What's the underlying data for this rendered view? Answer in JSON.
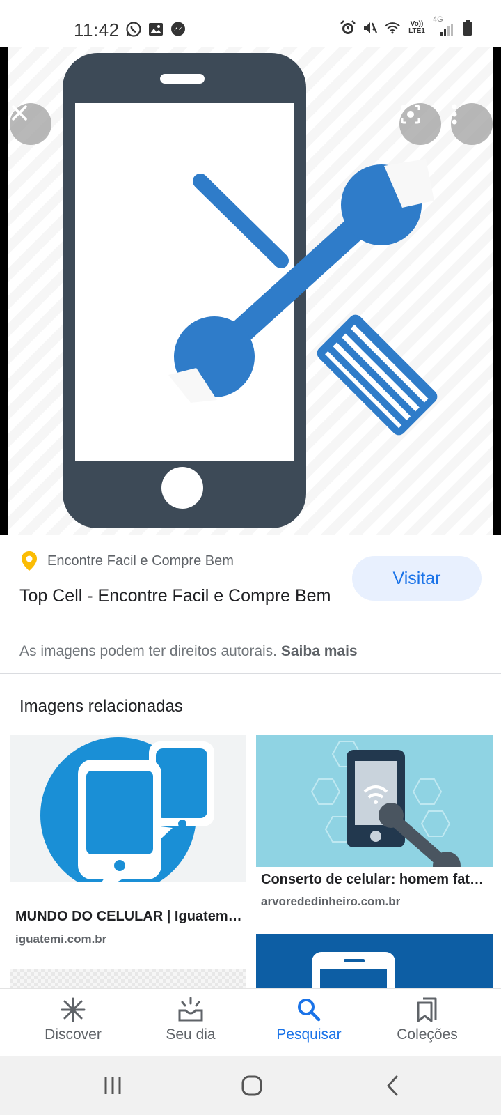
{
  "status_bar": {
    "time": "11:42",
    "left_icons": [
      "whatsapp-icon",
      "gallery-icon",
      "messenger-icon"
    ],
    "right_icons": [
      "alarm-icon",
      "mute-icon",
      "wifi-icon",
      "volte-icon",
      "signal-icon",
      "battery-icon"
    ],
    "volte_top": "Vo))",
    "volte_bottom": "LTE1",
    "network": "4G"
  },
  "hero": {
    "close_icon": "close-icon",
    "lens_icon": "lens-icon",
    "more_icon": "more-vert-icon"
  },
  "result": {
    "source": "Encontre Facil e Compre Bem",
    "title": "Top Cell - Encontre Facil e Compre Bem",
    "visit_label": "Visitar",
    "copyright_text": "As imagens podem ter direitos autorais.",
    "learn_more": "Saiba mais"
  },
  "related": {
    "heading": "Imagens relacionadas",
    "items": [
      {
        "title": "MUNDO DO CELULAR | Iguatem…",
        "domain": "iguatemi.com.br"
      },
      {
        "title": "Conserto de celular: homem fat…",
        "domain": "arvorededinheiro.com.br"
      }
    ]
  },
  "bottom_nav": {
    "items": [
      {
        "label": "Discover",
        "icon": "asterisk-icon",
        "active": false
      },
      {
        "label": "Seu dia",
        "icon": "sunrise-icon",
        "active": false
      },
      {
        "label": "Pesquisar",
        "icon": "search-icon",
        "active": true
      },
      {
        "label": "Coleções",
        "icon": "bookmarks-icon",
        "active": false
      }
    ]
  },
  "colors": {
    "accent": "#1a73e8",
    "visit_bg": "#e8f0fe",
    "phone_dark": "#3d4a57",
    "tool_blue": "#2f7cc9",
    "related_blue": "#1a8fd6",
    "related_cyan": "#8fd3e3"
  }
}
